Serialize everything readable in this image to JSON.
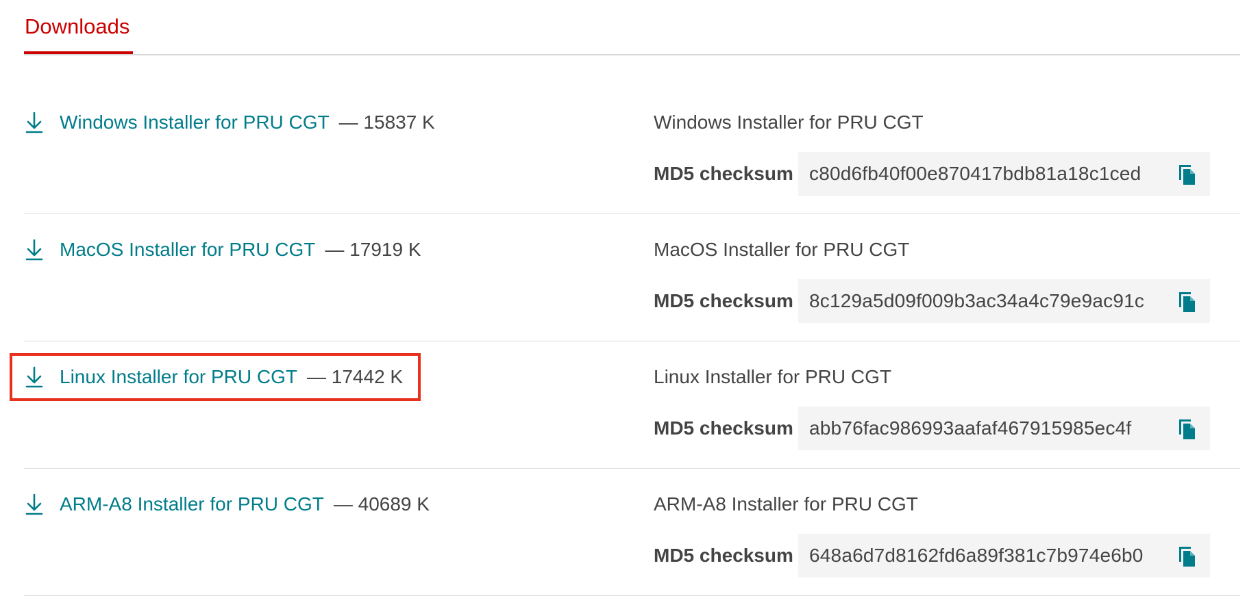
{
  "tabs": {
    "active_label": "Downloads"
  },
  "colors": {
    "accent": "#cc0000",
    "link": "#007c8a",
    "highlight_box": "#e8301c"
  },
  "downloads": [
    {
      "name": "Windows Installer for PRU CGT",
      "size": "— 15837 K",
      "title": "Windows Installer for PRU CGT",
      "md5_label": "MD5 checksum",
      "md5": "c80d6fb40f00e870417bdb81a18c1ced"
    },
    {
      "name": "MacOS Installer for PRU CGT",
      "size": "— 17919 K",
      "title": "MacOS Installer for PRU CGT",
      "md5_label": "MD5 checksum",
      "md5": "8c129a5d09f009b3ac34a4c79e9ac91c"
    },
    {
      "name": "Linux Installer for PRU CGT",
      "size": "— 17442 K",
      "title": "Linux Installer for PRU CGT",
      "md5_label": "MD5 checksum",
      "md5": "abb76fac986993aafaf467915985ec4f",
      "highlighted": true
    },
    {
      "name": "ARM-A8 Installer for PRU CGT",
      "size": "— 40689 K",
      "title": "ARM-A8 Installer for PRU CGT",
      "md5_label": "MD5 checksum",
      "md5": "648a6d7d8162fd6a89f381c7b974e6b0"
    }
  ],
  "icons": {
    "download": "download-icon",
    "copy": "copy-icon"
  }
}
